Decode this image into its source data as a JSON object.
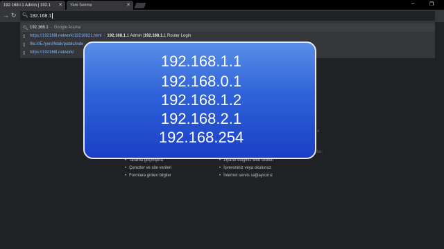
{
  "tabs": [
    {
      "title": "192.168.l.1 Admin | 192.1"
    },
    {
      "title": "Yeni Sekme"
    }
  ],
  "window_controls": {
    "minimize": "–",
    "maximize": "❐"
  },
  "omnibox": {
    "value": "192.168.1"
  },
  "suggestions": [
    {
      "icon": "search-icon",
      "text": "192.168.1",
      "meta": "Google Arama"
    },
    {
      "icon": "page-icon",
      "url": "https://192168l.network/19216821.html",
      "title_pre": "192.168.1.",
      "title_mid": "1 Admin | ",
      "title_bold": "192.168.1.",
      "title_post": "1 Router Login"
    },
    {
      "icon": "page-icon",
      "url": "file:///E:/yeni/felak/public/inde"
    },
    {
      "icon": "page-icon",
      "url": "https://192168l.network/"
    }
  ],
  "overlay_ips": [
    "192.168.1.1",
    "192.168.0.1",
    "192.168.1.2",
    "192.168.2.1",
    "192.168.254"
  ],
  "left_list": [
    "Tarama geçmişiniz",
    "Çerezler ve site verileri",
    "Formlara girilen bilgiler"
  ],
  "right_list": [
    "Ziyaret ettiğiniz web siteleri",
    "İşvereniniz veya okulunuz",
    "İnternet servis sağlayıcınız"
  ],
  "faded_right": "lar:",
  "faded_mid": "e"
}
